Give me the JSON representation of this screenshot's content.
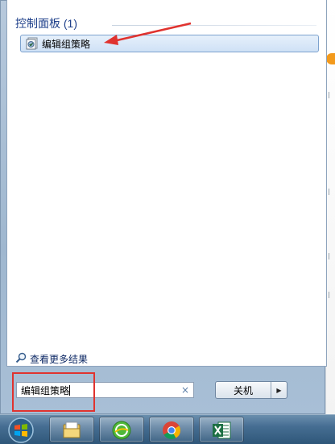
{
  "start_menu": {
    "section_title": "控制面板 (1)",
    "result_item_label": "编辑组策略",
    "more_results_label": "查看更多结果",
    "search": {
      "value": "编辑组策略",
      "clear_glyph": "×"
    },
    "shutdown": {
      "label": "关机",
      "arrow_glyph": "▶"
    }
  },
  "taskbar": {
    "items": [
      "file-explorer",
      "360-browser",
      "chrome",
      "excel"
    ]
  },
  "colors": {
    "annotation_red": "#e0332f",
    "title_blue": "#1e3f8a"
  }
}
